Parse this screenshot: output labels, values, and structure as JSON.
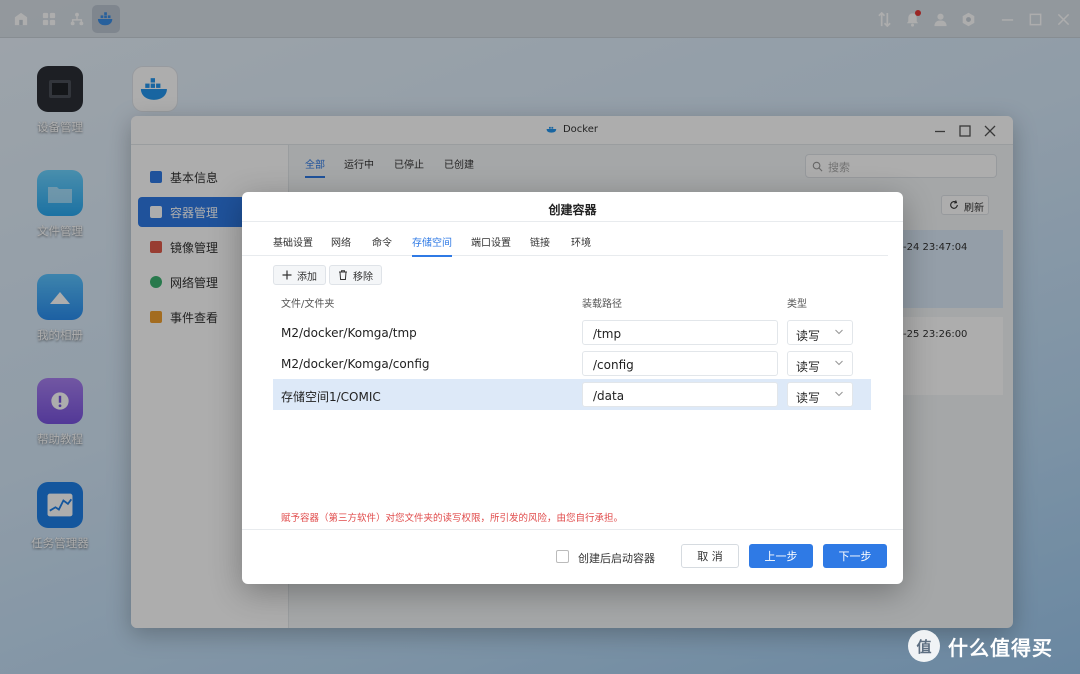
{
  "topbar": {
    "left_icons": [
      "home-icon",
      "apps-grid-icon",
      "network-icon",
      "docker-icon"
    ],
    "right_icons": [
      "transfer-icon",
      "bell-icon",
      "user-icon",
      "settings-icon",
      "minimize-icon",
      "maximize-icon",
      "close-icon"
    ]
  },
  "desktop": {
    "icons": [
      {
        "label": "设备管理"
      },
      {
        "label": "文件管理"
      },
      {
        "label": "我的相册"
      },
      {
        "label": "帮助教程"
      },
      {
        "label": "任务管理器"
      }
    ]
  },
  "docker_window": {
    "title": "Docker",
    "sidebar": [
      "基本信息",
      "容器管理",
      "镜像管理",
      "网络管理",
      "事件查看"
    ],
    "tabs": [
      "全部",
      "运行中",
      "已停止",
      "已创建"
    ],
    "active_tab": "全部",
    "search_placeholder": "搜索",
    "refresh_label": "刷新",
    "bg_rows": [
      "-24 23:47:04",
      "-25 23:26:00"
    ]
  },
  "dialog": {
    "title": "创建容器",
    "tabs": [
      "基础设置",
      "网络",
      "命令",
      "存储空间",
      "端口设置",
      "链接",
      "环境"
    ],
    "active_tab": "存储空间",
    "add_label": "添加",
    "remove_label": "移除",
    "columns": [
      "文件/文件夹",
      "装载路径",
      "类型"
    ],
    "rows": [
      {
        "path": "M2/docker/Komga/tmp",
        "mount": "/tmp",
        "type": "读写"
      },
      {
        "path": "M2/docker/Komga/config",
        "mount": "/config",
        "type": "读写"
      },
      {
        "path": "存储空间1/COMIC",
        "mount": "/data",
        "type": "读写"
      }
    ],
    "warning": "赋予容器（第三方软件）对您文件夹的读写权限，所引发的风险，由您自行承担。",
    "start_after_create": "创建后启动容器",
    "cancel_label": "取 消",
    "prev_label": "上一步",
    "next_label": "下一步"
  },
  "watermark": {
    "logo": "值",
    "text": "什么值得买"
  },
  "colors": {
    "accent": "#2f7ae5",
    "warning": "#e04b4b",
    "selected_row": "#dde9f8"
  }
}
